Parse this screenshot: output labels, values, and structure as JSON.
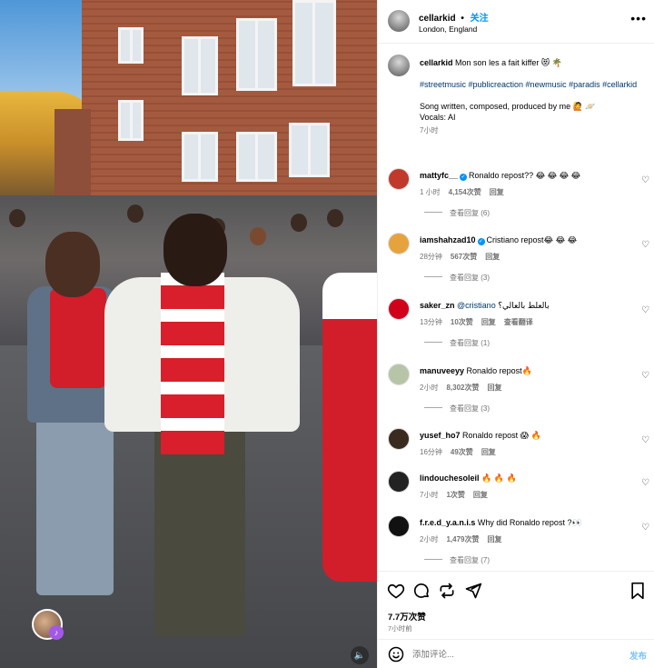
{
  "header": {
    "username": "cellarkid",
    "separator": "•",
    "follow_label": "关注",
    "location": "London, England",
    "more_icon": "more-horizontal-icon"
  },
  "caption": {
    "username": "cellarkid",
    "text": "Mon son les a fait kiffer 😻 🌴",
    "hashtags": "#streetmusic #publicreaction #newmusic #paradis #cellarkid",
    "line1": "Song written, composed, produced by me 🙋 🪐",
    "line2": "Vocals: AI",
    "time": "7小时"
  },
  "comments": [
    {
      "username": "mattyfc__",
      "verified": true,
      "text": "Ronaldo repost?? 😂 😂 😂 😂",
      "time": "1 小时",
      "likes": "4,154次赞",
      "reply": "回复",
      "translate": "",
      "view_replies": "查看回复 (6)",
      "avatar_color": "#c0392b"
    },
    {
      "username": "iamshahzad10",
      "verified": true,
      "text": "Cristiano repost😂 😂 😂",
      "time": "28分钟",
      "likes": "567次赞",
      "reply": "回复",
      "translate": "",
      "view_replies": "查看回复 (3)",
      "avatar_color": "#e6a23c"
    },
    {
      "username": "saker_zn",
      "verified": false,
      "mention": "@cristiano",
      "text": "بالعلط بالعالي؟",
      "time": "13分钟",
      "likes": "10次赞",
      "reply": "回复",
      "translate": "查看翻译",
      "view_replies": "查看回复 (1)",
      "avatar_color": "#d0021b"
    },
    {
      "username": "manuveeyy",
      "verified": false,
      "text": "Ronaldo repost🔥",
      "time": "2小时",
      "likes": "8,302次赞",
      "reply": "回复",
      "translate": "",
      "view_replies": "查看回复 (3)",
      "avatar_color": "#b7c4a8"
    },
    {
      "username": "yusef_ho7",
      "verified": false,
      "text": "Ronaldo repost 😱 🔥",
      "time": "16分钟",
      "likes": "49次赞",
      "reply": "回复",
      "translate": "",
      "view_replies": "",
      "avatar_color": "#3a2a20"
    },
    {
      "username": "lindouchesoleil",
      "verified": false,
      "text": "🔥 🔥 🔥",
      "time": "7小时",
      "likes": "1次赞",
      "reply": "回复",
      "translate": "",
      "view_replies": "",
      "avatar_color": "#222222"
    },
    {
      "username": "f.r.e.d_y.a.n.i.s",
      "verified": false,
      "text": "Why did Ronaldo repost ?👀",
      "time": "2小时",
      "likes": "1,479次赞",
      "reply": "回复",
      "translate": "",
      "view_replies": "查看回复 (7)",
      "avatar_color": "#111111"
    }
  ],
  "actions": {
    "likes": "7.7万次赞",
    "time_ago": "7小时前"
  },
  "compose": {
    "placeholder": "添加评论...",
    "post_label": "发布"
  },
  "colors": {
    "accent": "#0095f6",
    "muted": "#737373",
    "link": "#00376b"
  }
}
